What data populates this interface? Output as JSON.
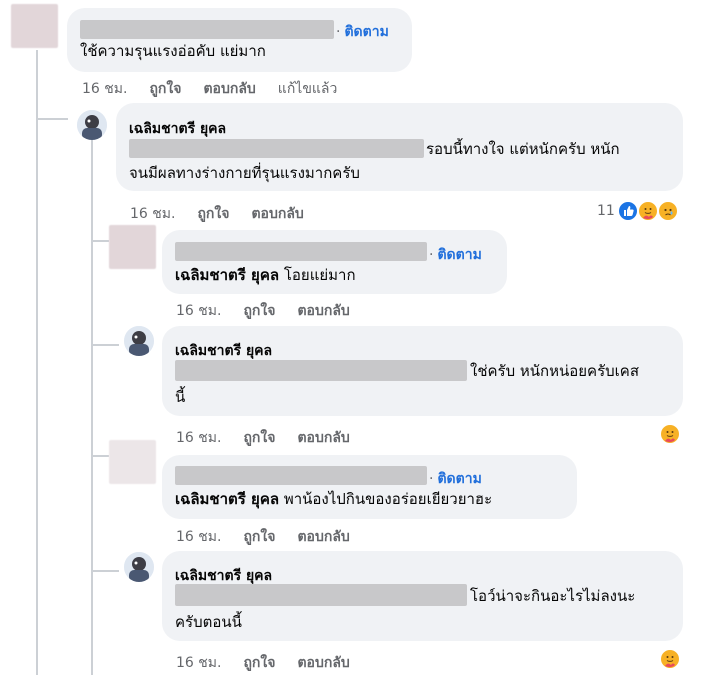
{
  "comments": [
    {
      "name": "",
      "text": "ใช้ความรุนแรงอ่อคับ แย่มาก",
      "follow": "ติดตาม",
      "time": "16 ชม.",
      "like": "ถูกใจ",
      "reply": "ตอบกลับ",
      "edited": "แก้ไขแล้ว"
    },
    {
      "name": "เฉลิมชาตรี ยุคล",
      "text_line1": "รอบนี้ทางใจ แต่หนักครับ หนัก",
      "text_line2": "จนมีผลทางร่างกายที่รุนแรงมากครับ",
      "time": "16 ชม.",
      "like": "ถูกใจ",
      "reply": "ตอบกลับ",
      "reactions_count": "11",
      "reactions": [
        "like-icon",
        "care-icon",
        "sad-icon"
      ]
    },
    {
      "follow": "ติดตาม",
      "mention": "เฉลิมชาตรี ยุคล",
      "text": "โอยแย่มาก",
      "time": "16 ชม.",
      "like": "ถูกใจ",
      "reply": "ตอบกลับ"
    },
    {
      "name": "เฉลิมชาตรี ยุคล",
      "text_line1": "ใช่ครับ หนักหน่อยครับเคส",
      "text_line2": "นี้",
      "time": "16 ชม.",
      "like": "ถูกใจ",
      "reply": "ตอบกลับ",
      "reactions": [
        "care-icon"
      ]
    },
    {
      "follow": "ติดตาม",
      "mention": "เฉลิมชาตรี ยุคล",
      "text": "พาน้องไปกินของอร่อยเยียวยาฮะ",
      "time": "16 ชม.",
      "like": "ถูกใจ",
      "reply": "ตอบกลับ"
    },
    {
      "name": "เฉลิมชาตรี ยุคล",
      "text_line1": "โอว์น่าจะกินอะไรไม่ลงนะ",
      "text_line2": "ครับตอนนี้",
      "time": "16 ชม.",
      "like": "ถูกใจ",
      "reply": "ตอบกลับ",
      "reactions": [
        "care-icon"
      ]
    }
  ]
}
